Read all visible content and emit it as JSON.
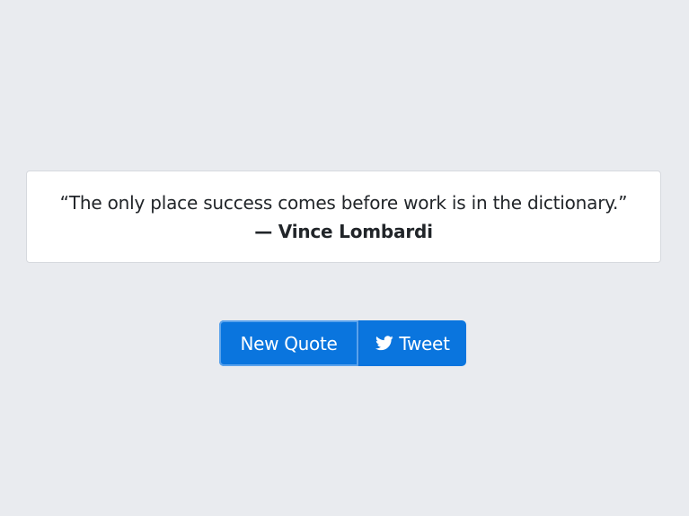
{
  "quote": {
    "text": "“The only place success comes before work is in the dictionary.”",
    "author": "— Vince Lombardi"
  },
  "buttons": {
    "new_quote_label": "New Quote",
    "tweet_label": "Tweet",
    "tweet_icon": "twitter-icon"
  },
  "colors": {
    "background": "#e9ebef",
    "accent": "#0a75de",
    "card": "#ffffff"
  }
}
